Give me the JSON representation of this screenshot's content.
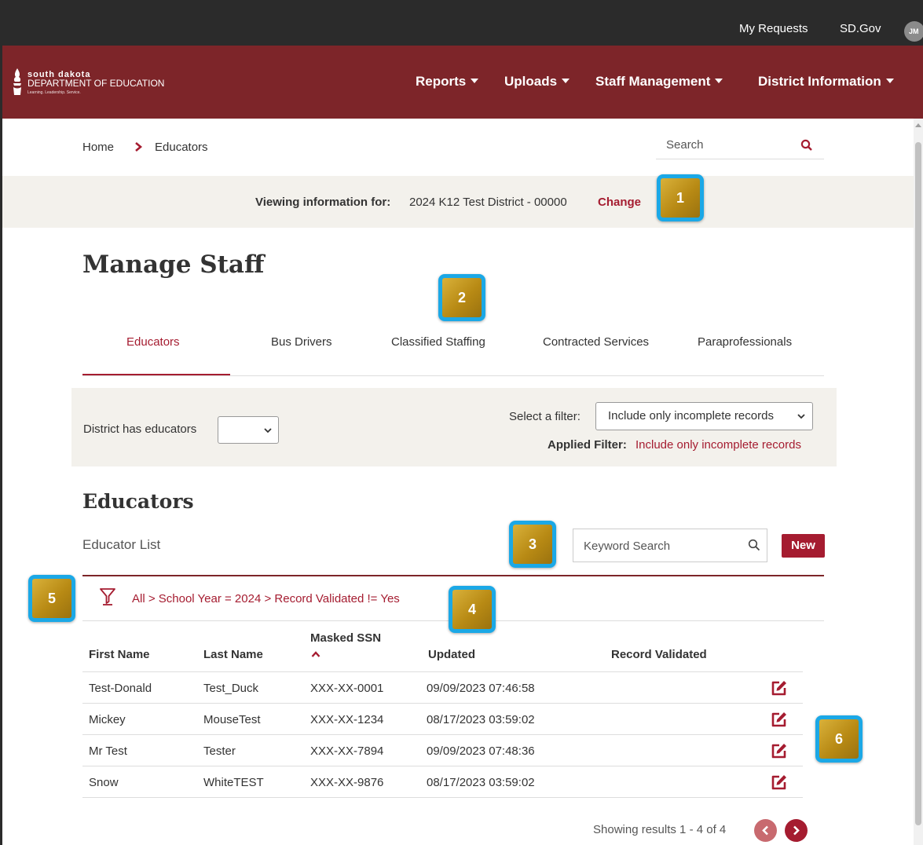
{
  "utility": {
    "my_requests": "My Requests",
    "sd_gov": "SD.Gov",
    "avatar_initials": "JM"
  },
  "logo": {
    "line1": "south dakota",
    "line2": "DEPARTMENT OF EDUCATION",
    "line3": "Learning. Leadership. Service."
  },
  "nav": {
    "reports": "Reports",
    "uploads": "Uploads",
    "staff_management": "Staff Management",
    "district_information": "District Information"
  },
  "breadcrumb": {
    "home": "Home",
    "current": "Educators"
  },
  "site_search": {
    "placeholder": "Search"
  },
  "viewing": {
    "label": "Viewing information for:",
    "value": "2024 K12 Test District - 00000",
    "change": "Change"
  },
  "callouts": [
    "1",
    "2",
    "3",
    "4",
    "5",
    "6"
  ],
  "page_title": "Manage Staff",
  "tabs": [
    {
      "label": "Educators",
      "active": true
    },
    {
      "label": "Bus Drivers",
      "active": false
    },
    {
      "label": "Classified Staffing",
      "active": false
    },
    {
      "label": "Contracted Services",
      "active": false
    },
    {
      "label": "Paraprofessionals",
      "active": false
    }
  ],
  "filters": {
    "district_has_label": "District has educators",
    "district_has_value": "",
    "select_label": "Select a filter:",
    "select_value": "Include only incomplete records",
    "applied_label": "Applied Filter:",
    "applied_value": "Include only incomplete records"
  },
  "educators": {
    "section_title": "Educators",
    "list_title": "Educator List",
    "keyword_placeholder": "Keyword Search",
    "new_label": "New",
    "filter_path": "All > School Year = 2024 > Record Validated != Yes"
  },
  "table": {
    "headers": {
      "first_name": "First Name",
      "last_name": "Last Name",
      "masked_ssn": "Masked SSN",
      "updated": "Updated",
      "record_validated": "Record Validated"
    },
    "rows": [
      {
        "first": "Test-Donald",
        "last": "Test_Duck",
        "ssn": "XXX-XX-0001",
        "updated": "09/09/2023 07:46:58",
        "validated": ""
      },
      {
        "first": "Mickey",
        "last": "MouseTest",
        "ssn": "XXX-XX-1234",
        "updated": "08/17/2023 03:59:02",
        "validated": ""
      },
      {
        "first": "Mr Test",
        "last": "Tester",
        "ssn": "XXX-XX-7894",
        "updated": "09/09/2023 07:48:36",
        "validated": ""
      },
      {
        "first": "Snow",
        "last": "WhiteTEST",
        "ssn": "XXX-XX-9876",
        "updated": "08/17/2023 03:59:02",
        "validated": ""
      }
    ]
  },
  "pagination": {
    "results_text": "Showing results 1 - 4 of 4"
  },
  "colors": {
    "brand_maroon": "#7d2529",
    "accent_red": "#a51c30",
    "callout_border": "#1ba8e6",
    "callout_fill": "#c9a027"
  }
}
